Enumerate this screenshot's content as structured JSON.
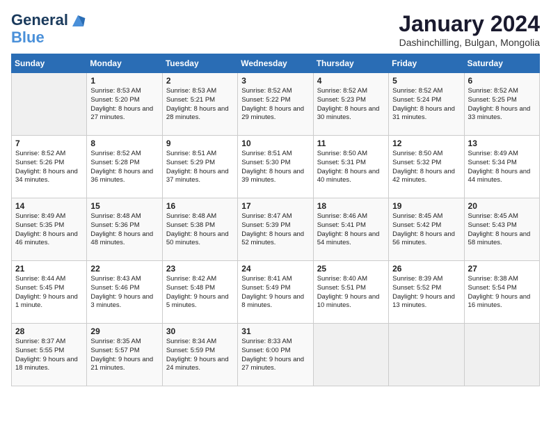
{
  "header": {
    "logo_line1": "General",
    "logo_line2": "Blue",
    "month_title": "January 2024",
    "location": "Dashinchilling, Bulgan, Mongolia"
  },
  "weekdays": [
    "Sunday",
    "Monday",
    "Tuesday",
    "Wednesday",
    "Thursday",
    "Friday",
    "Saturday"
  ],
  "weeks": [
    [
      {
        "day": "",
        "sunrise": "",
        "sunset": "",
        "daylight": ""
      },
      {
        "day": "1",
        "sunrise": "Sunrise: 8:53 AM",
        "sunset": "Sunset: 5:20 PM",
        "daylight": "Daylight: 8 hours and 27 minutes."
      },
      {
        "day": "2",
        "sunrise": "Sunrise: 8:53 AM",
        "sunset": "Sunset: 5:21 PM",
        "daylight": "Daylight: 8 hours and 28 minutes."
      },
      {
        "day": "3",
        "sunrise": "Sunrise: 8:52 AM",
        "sunset": "Sunset: 5:22 PM",
        "daylight": "Daylight: 8 hours and 29 minutes."
      },
      {
        "day": "4",
        "sunrise": "Sunrise: 8:52 AM",
        "sunset": "Sunset: 5:23 PM",
        "daylight": "Daylight: 8 hours and 30 minutes."
      },
      {
        "day": "5",
        "sunrise": "Sunrise: 8:52 AM",
        "sunset": "Sunset: 5:24 PM",
        "daylight": "Daylight: 8 hours and 31 minutes."
      },
      {
        "day": "6",
        "sunrise": "Sunrise: 8:52 AM",
        "sunset": "Sunset: 5:25 PM",
        "daylight": "Daylight: 8 hours and 33 minutes."
      }
    ],
    [
      {
        "day": "7",
        "sunrise": "Sunrise: 8:52 AM",
        "sunset": "Sunset: 5:26 PM",
        "daylight": "Daylight: 8 hours and 34 minutes."
      },
      {
        "day": "8",
        "sunrise": "Sunrise: 8:52 AM",
        "sunset": "Sunset: 5:28 PM",
        "daylight": "Daylight: 8 hours and 36 minutes."
      },
      {
        "day": "9",
        "sunrise": "Sunrise: 8:51 AM",
        "sunset": "Sunset: 5:29 PM",
        "daylight": "Daylight: 8 hours and 37 minutes."
      },
      {
        "day": "10",
        "sunrise": "Sunrise: 8:51 AM",
        "sunset": "Sunset: 5:30 PM",
        "daylight": "Daylight: 8 hours and 39 minutes."
      },
      {
        "day": "11",
        "sunrise": "Sunrise: 8:50 AM",
        "sunset": "Sunset: 5:31 PM",
        "daylight": "Daylight: 8 hours and 40 minutes."
      },
      {
        "day": "12",
        "sunrise": "Sunrise: 8:50 AM",
        "sunset": "Sunset: 5:32 PM",
        "daylight": "Daylight: 8 hours and 42 minutes."
      },
      {
        "day": "13",
        "sunrise": "Sunrise: 8:49 AM",
        "sunset": "Sunset: 5:34 PM",
        "daylight": "Daylight: 8 hours and 44 minutes."
      }
    ],
    [
      {
        "day": "14",
        "sunrise": "Sunrise: 8:49 AM",
        "sunset": "Sunset: 5:35 PM",
        "daylight": "Daylight: 8 hours and 46 minutes."
      },
      {
        "day": "15",
        "sunrise": "Sunrise: 8:48 AM",
        "sunset": "Sunset: 5:36 PM",
        "daylight": "Daylight: 8 hours and 48 minutes."
      },
      {
        "day": "16",
        "sunrise": "Sunrise: 8:48 AM",
        "sunset": "Sunset: 5:38 PM",
        "daylight": "Daylight: 8 hours and 50 minutes."
      },
      {
        "day": "17",
        "sunrise": "Sunrise: 8:47 AM",
        "sunset": "Sunset: 5:39 PM",
        "daylight": "Daylight: 8 hours and 52 minutes."
      },
      {
        "day": "18",
        "sunrise": "Sunrise: 8:46 AM",
        "sunset": "Sunset: 5:41 PM",
        "daylight": "Daylight: 8 hours and 54 minutes."
      },
      {
        "day": "19",
        "sunrise": "Sunrise: 8:45 AM",
        "sunset": "Sunset: 5:42 PM",
        "daylight": "Daylight: 8 hours and 56 minutes."
      },
      {
        "day": "20",
        "sunrise": "Sunrise: 8:45 AM",
        "sunset": "Sunset: 5:43 PM",
        "daylight": "Daylight: 8 hours and 58 minutes."
      }
    ],
    [
      {
        "day": "21",
        "sunrise": "Sunrise: 8:44 AM",
        "sunset": "Sunset: 5:45 PM",
        "daylight": "Daylight: 9 hours and 1 minute."
      },
      {
        "day": "22",
        "sunrise": "Sunrise: 8:43 AM",
        "sunset": "Sunset: 5:46 PM",
        "daylight": "Daylight: 9 hours and 3 minutes."
      },
      {
        "day": "23",
        "sunrise": "Sunrise: 8:42 AM",
        "sunset": "Sunset: 5:48 PM",
        "daylight": "Daylight: 9 hours and 5 minutes."
      },
      {
        "day": "24",
        "sunrise": "Sunrise: 8:41 AM",
        "sunset": "Sunset: 5:49 PM",
        "daylight": "Daylight: 9 hours and 8 minutes."
      },
      {
        "day": "25",
        "sunrise": "Sunrise: 8:40 AM",
        "sunset": "Sunset: 5:51 PM",
        "daylight": "Daylight: 9 hours and 10 minutes."
      },
      {
        "day": "26",
        "sunrise": "Sunrise: 8:39 AM",
        "sunset": "Sunset: 5:52 PM",
        "daylight": "Daylight: 9 hours and 13 minutes."
      },
      {
        "day": "27",
        "sunrise": "Sunrise: 8:38 AM",
        "sunset": "Sunset: 5:54 PM",
        "daylight": "Daylight: 9 hours and 16 minutes."
      }
    ],
    [
      {
        "day": "28",
        "sunrise": "Sunrise: 8:37 AM",
        "sunset": "Sunset: 5:55 PM",
        "daylight": "Daylight: 9 hours and 18 minutes."
      },
      {
        "day": "29",
        "sunrise": "Sunrise: 8:35 AM",
        "sunset": "Sunset: 5:57 PM",
        "daylight": "Daylight: 9 hours and 21 minutes."
      },
      {
        "day": "30",
        "sunrise": "Sunrise: 8:34 AM",
        "sunset": "Sunset: 5:59 PM",
        "daylight": "Daylight: 9 hours and 24 minutes."
      },
      {
        "day": "31",
        "sunrise": "Sunrise: 8:33 AM",
        "sunset": "Sunset: 6:00 PM",
        "daylight": "Daylight: 9 hours and 27 minutes."
      },
      {
        "day": "",
        "sunrise": "",
        "sunset": "",
        "daylight": ""
      },
      {
        "day": "",
        "sunrise": "",
        "sunset": "",
        "daylight": ""
      },
      {
        "day": "",
        "sunrise": "",
        "sunset": "",
        "daylight": ""
      }
    ]
  ]
}
